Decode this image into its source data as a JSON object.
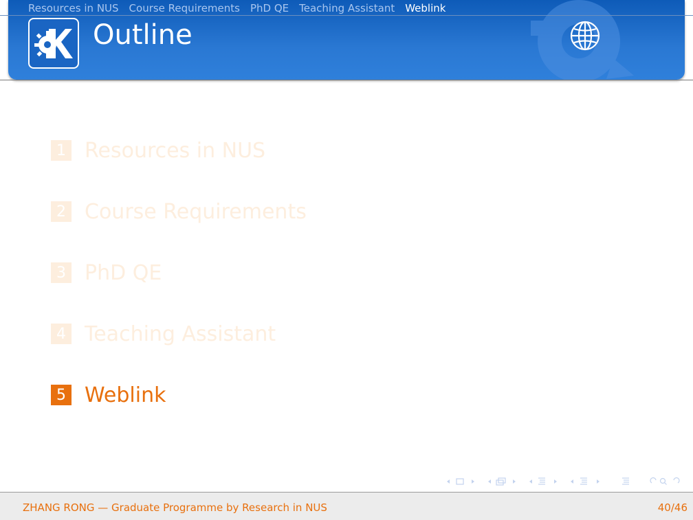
{
  "header": {
    "nav": [
      {
        "label": "Resources in NUS",
        "active": false
      },
      {
        "label": "Course Requirements",
        "active": false
      },
      {
        "label": "PhD QE",
        "active": false
      },
      {
        "label": "Teaching Assistant",
        "active": false
      },
      {
        "label": "Weblink",
        "active": true
      }
    ],
    "title": "Outline",
    "logo_icon": "kde-logo-icon",
    "decoration_icon": "globe-icon"
  },
  "toc": [
    {
      "number": "1",
      "label": "Resources in NUS",
      "current": false
    },
    {
      "number": "2",
      "label": "Course Requirements",
      "current": false
    },
    {
      "number": "3",
      "label": "PhD QE",
      "current": false
    },
    {
      "number": "4",
      "label": "Teaching Assistant",
      "current": false
    },
    {
      "number": "5",
      "label": "Weblink",
      "current": true
    }
  ],
  "footer": {
    "left": "ZHANG RONG — Graduate Programme by Research in NUS",
    "page": "40/46"
  },
  "colors": {
    "header_blue": "#2a78d3",
    "accent_orange": "#e8700e",
    "faded_orange": "#fdeede"
  }
}
